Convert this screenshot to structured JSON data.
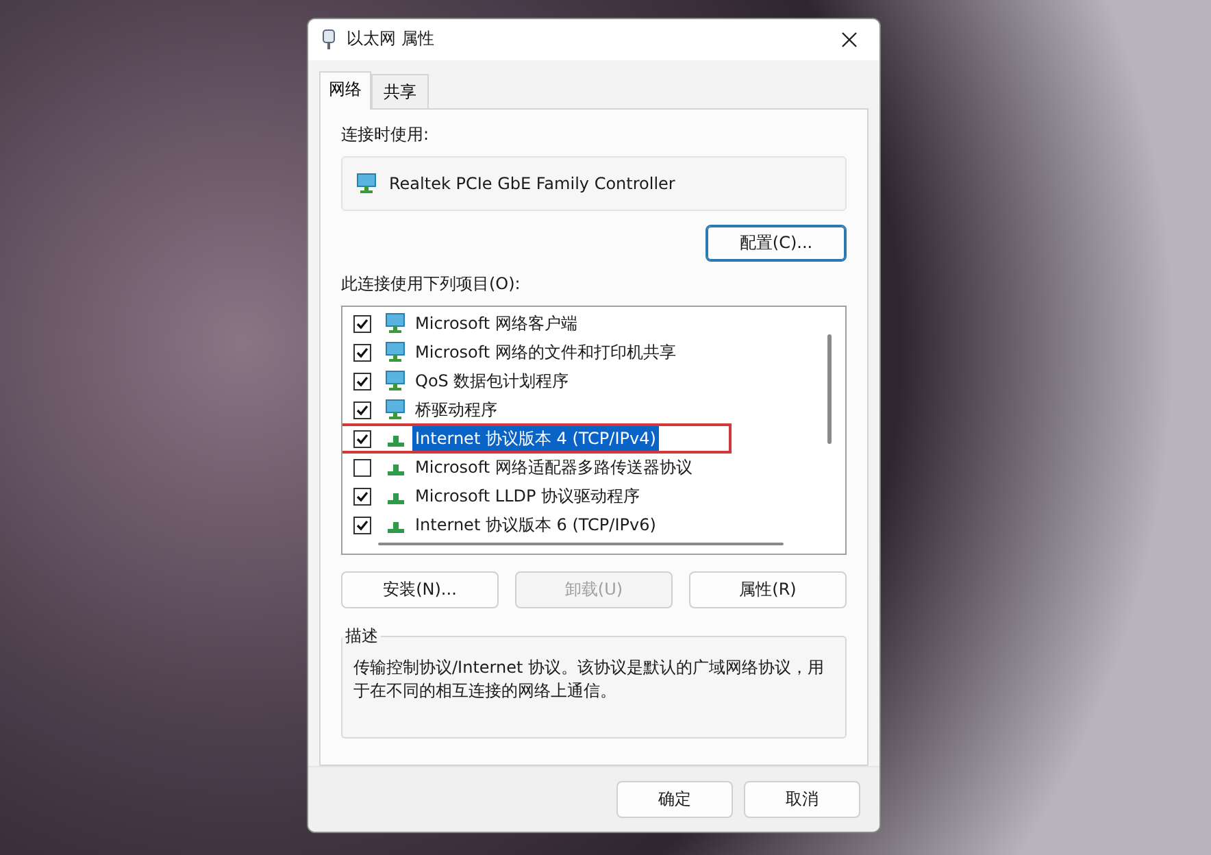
{
  "window": {
    "title": "以太网 属性"
  },
  "tabs": [
    {
      "label": "网络",
      "selected": true
    },
    {
      "label": "共享",
      "selected": false
    }
  ],
  "adapter": {
    "label": "连接时使用:",
    "name": "Realtek PCIe GbE Family Controller",
    "configure_button": "配置(C)..."
  },
  "items_label": "此连接使用下列项目(O):",
  "items": [
    {
      "label": "Microsoft 网络客户端",
      "kind": "client",
      "checked": true,
      "selected": false,
      "marked": false
    },
    {
      "label": "Microsoft 网络的文件和打印机共享",
      "kind": "client",
      "checked": true,
      "selected": false,
      "marked": false
    },
    {
      "label": "QoS 数据包计划程序",
      "kind": "client",
      "checked": true,
      "selected": false,
      "marked": false
    },
    {
      "label": "桥驱动程序",
      "kind": "client",
      "checked": true,
      "selected": false,
      "marked": false
    },
    {
      "label": "Internet 协议版本 4 (TCP/IPv4)",
      "kind": "protocol",
      "checked": true,
      "selected": true,
      "marked": true
    },
    {
      "label": "Microsoft 网络适配器多路传送器协议",
      "kind": "protocol",
      "checked": false,
      "selected": false,
      "marked": false
    },
    {
      "label": "Microsoft LLDP 协议驱动程序",
      "kind": "protocol",
      "checked": true,
      "selected": false,
      "marked": false
    },
    {
      "label": "Internet 协议版本 6 (TCP/IPv6)",
      "kind": "protocol",
      "checked": true,
      "selected": false,
      "marked": false
    }
  ],
  "item_buttons": [
    {
      "label": "安装(N)...",
      "disabled": false
    },
    {
      "label": "卸载(U)",
      "disabled": true
    },
    {
      "label": "属性(R)",
      "disabled": false
    }
  ],
  "description": {
    "title": "描述",
    "text": "传输控制协议/Internet 协议。该协议是默认的广域网络协议，用于在不同的相互连接的网络上通信。"
  },
  "footer_buttons": [
    "确定",
    "取消"
  ]
}
